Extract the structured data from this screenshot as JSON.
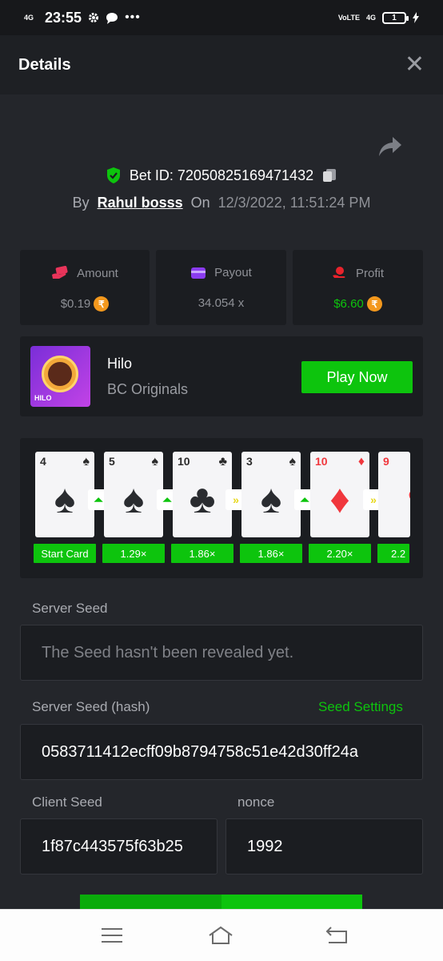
{
  "status": {
    "network": "4G",
    "time": "23:55",
    "volte": "VoLTE",
    "network2": "4G",
    "battery": "1"
  },
  "header": {
    "title": "Details",
    "close_icon": "close-icon"
  },
  "bet": {
    "bet_id_label": "Bet ID: 72050825169471432",
    "by_label": "By",
    "user": "Rahul bosss",
    "on_label": "On",
    "datetime": "12/3/2022, 11:51:24 PM"
  },
  "stats": {
    "amount": {
      "label": "Amount",
      "value": "$0.19",
      "coin": "₹",
      "color": "#e8345a"
    },
    "payout": {
      "label": "Payout",
      "value": "34.054 x",
      "color": "#8b3cf0"
    },
    "profit": {
      "label": "Profit",
      "value": "$6.60",
      "coin": "₹",
      "color": "#e8232c"
    }
  },
  "game": {
    "name": "Hilo",
    "provider": "BC Originals",
    "thumb_label": "HILO",
    "play_label": "Play Now"
  },
  "cards": [
    {
      "rank": "4",
      "suit": "♠",
      "red": false,
      "mult": "Start Card"
    },
    {
      "rank": "5",
      "suit": "♠",
      "red": false,
      "mult": "1.29×",
      "arrow": "up"
    },
    {
      "rank": "10",
      "suit": "♣",
      "red": false,
      "mult": "1.86×",
      "arrow": "up"
    },
    {
      "rank": "3",
      "suit": "♠",
      "red": false,
      "mult": "1.86×",
      "arrow": "skip"
    },
    {
      "rank": "10",
      "suit": "♦",
      "red": true,
      "mult": "2.20×",
      "arrow": "up"
    },
    {
      "rank": "9",
      "suit": "♥",
      "red": true,
      "mult": "2.2",
      "arrow": "skip"
    }
  ],
  "seeds": {
    "server_seed_label": "Server Seed",
    "server_seed_value": "The Seed hasn't been revealed yet.",
    "server_hash_label": "Server Seed (hash)",
    "seed_settings_label": "Seed Settings",
    "server_hash_value": "0583711412ecff09b8794758c51e42d30ff24a",
    "client_seed_label": "Client Seed",
    "client_seed_value": "1f87c443575f63b25",
    "nonce_label": "nonce",
    "nonce_value": "1992"
  },
  "colors": {
    "accent_green": "#0dc40d",
    "background": "#24262b",
    "panel": "#1b1d21"
  }
}
